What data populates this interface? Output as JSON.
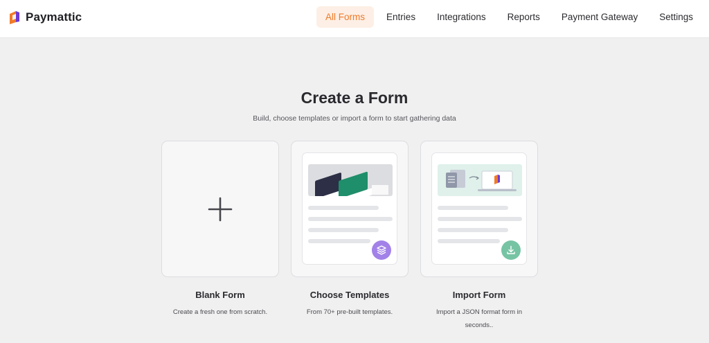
{
  "app": {
    "name": "Paymattic",
    "accent_color": "#f07a29",
    "logo_icon": "paymattic-logo"
  },
  "nav": {
    "items": [
      {
        "label": "All Forms",
        "active": true
      },
      {
        "label": "Entries"
      },
      {
        "label": "Integrations"
      },
      {
        "label": "Reports"
      },
      {
        "label": "Payment Gateway"
      },
      {
        "label": "Settings"
      }
    ]
  },
  "hero": {
    "title": "Create a Form",
    "subtitle": "Build, choose templates or import a form to start gathering data"
  },
  "cards": [
    {
      "title": "Blank Form",
      "description": "Create a fresh one from scratch.",
      "icon": "plus-icon"
    },
    {
      "title": "Choose Templates",
      "description": "From 70+ pre-built templates.",
      "icon": "layers-icon",
      "badge_color": "#a282e8"
    },
    {
      "title": "Import Form",
      "description": "Import a JSON format form in seconds..",
      "icon": "download-icon",
      "badge_color": "#76c4a4"
    }
  ]
}
